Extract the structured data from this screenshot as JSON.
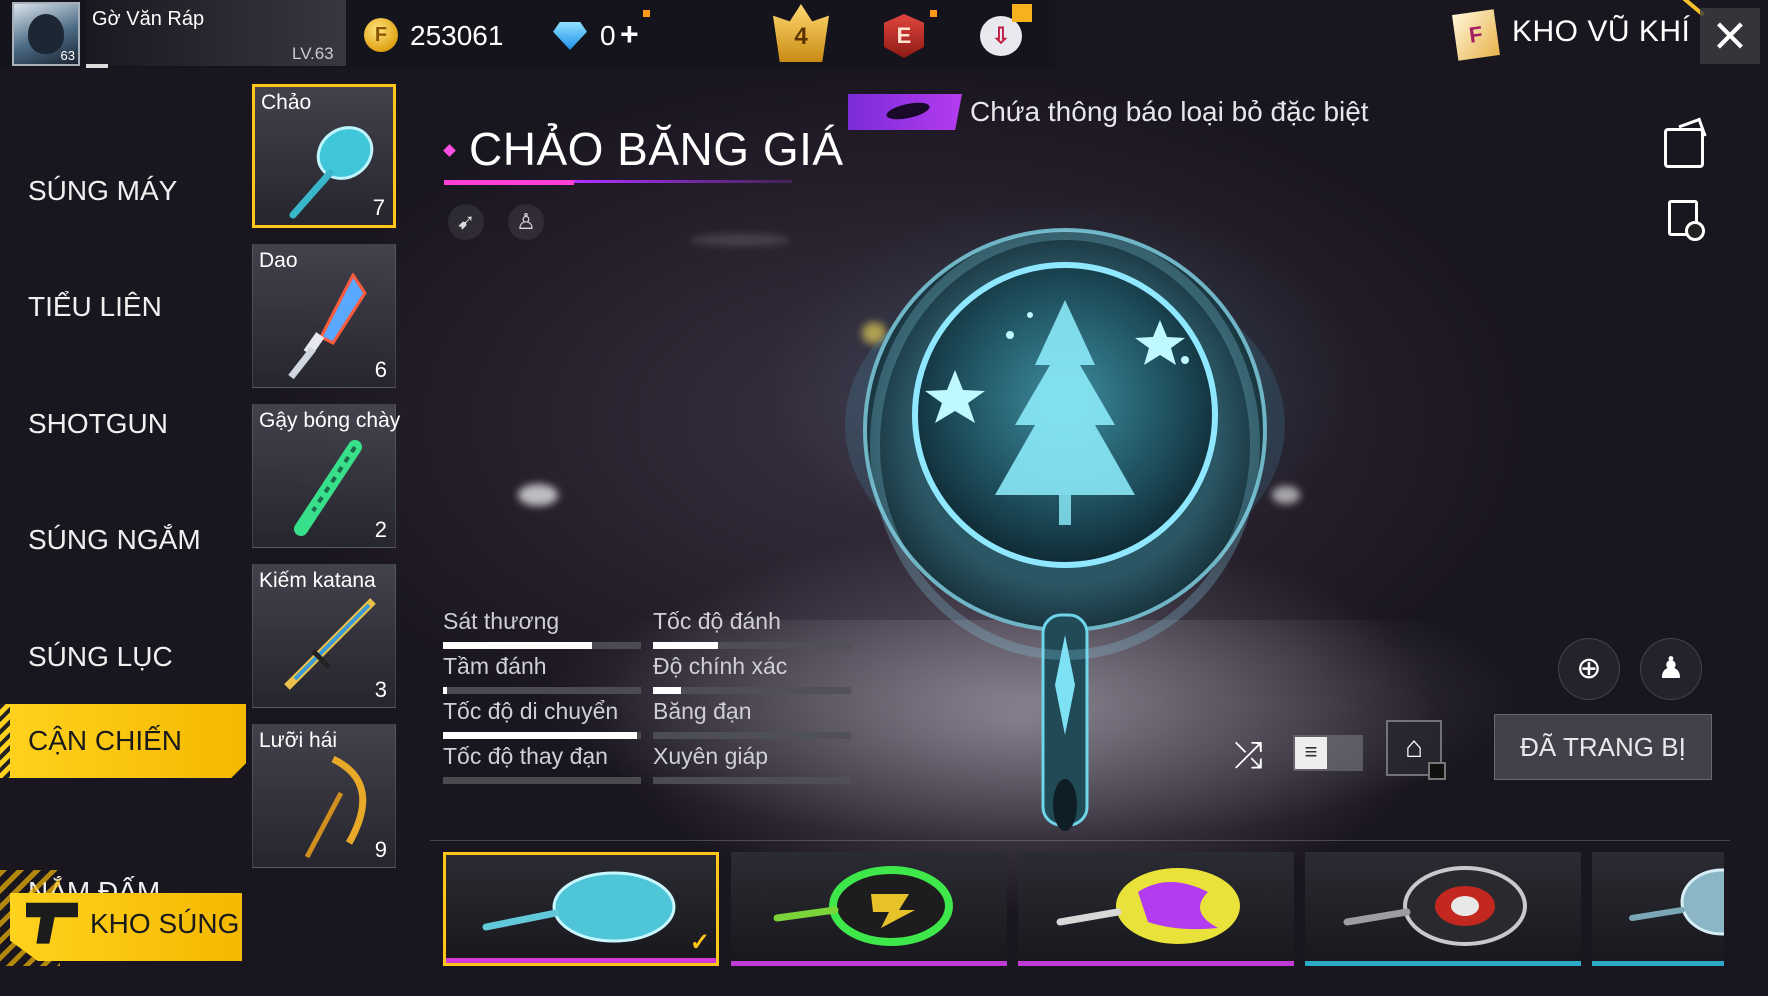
{
  "player": {
    "name": "Gờ Văn Ráp",
    "level": "LV.63",
    "avatar_level": "63"
  },
  "currency": {
    "gold": "253061",
    "diamonds": "0",
    "plus": "+"
  },
  "top_icons": {
    "rank_value": "4",
    "elite_letter": "E"
  },
  "header": {
    "title": "KHO VŨ KHÍ",
    "close": "×"
  },
  "categories": [
    {
      "label": "SÚNG MÁY",
      "active": false
    },
    {
      "label": "TIỂU LIÊN",
      "active": false
    },
    {
      "label": "SHOTGUN",
      "active": false
    },
    {
      "label": "SÚNG NGẮM",
      "active": false
    },
    {
      "label": "SÚNG LỤC",
      "active": false
    },
    {
      "label": "CẬN CHIẾN",
      "active": true
    },
    {
      "label": "NẮM ĐẤM",
      "active": false
    }
  ],
  "gun_storage": {
    "label": "KHO SÚNG"
  },
  "weapon_types": [
    {
      "name": "Chảo",
      "count": "7",
      "selected": true
    },
    {
      "name": "Dao",
      "count": "6",
      "selected": false
    },
    {
      "name": "Gậy bóng chày",
      "count": "2",
      "selected": false
    },
    {
      "name": "Kiếm katana",
      "count": "3",
      "selected": false
    },
    {
      "name": "Lưỡi hái",
      "count": "9",
      "selected": false
    }
  ],
  "weapon": {
    "title": "CHẢO BĂNG GIÁ",
    "notice": "Chứa thông báo loại bỏ đặc biệt"
  },
  "stats": [
    {
      "label": "Sát thương",
      "value": 0.75
    },
    {
      "label": "Tốc độ đánh",
      "value": 0.33
    },
    {
      "label": "Tầm đánh",
      "value": 0.02
    },
    {
      "label": "Độ chính xác",
      "value": 0.14
    },
    {
      "label": "Tốc độ di chuyển",
      "value": 0.98
    },
    {
      "label": "Băng đạn",
      "value": 0.0
    },
    {
      "label": "Tốc độ thay đạn",
      "value": 0.0
    },
    {
      "label": "Xuyên giáp",
      "value": 0.0
    }
  ],
  "actions": {
    "equipped": "ĐÃ TRANG BỊ",
    "toggle_glyph": "≡"
  },
  "skins": [
    {
      "theme": "ice",
      "selected": true,
      "bar": "#d639d8",
      "check": "✓"
    },
    {
      "theme": "green",
      "selected": false,
      "bar": "#c03ad8"
    },
    {
      "theme": "graffiti",
      "selected": false,
      "bar": "#c03ad8"
    },
    {
      "theme": "target",
      "selected": false,
      "bar": "#2aa9c9"
    },
    {
      "theme": "ice2",
      "selected": false,
      "bar": "#2aa9c9"
    }
  ],
  "colors": {
    "accent_yellow": "#ffc61a",
    "accent_magenta": "#ff3fd8",
    "notice_purple": "#9a34e8"
  }
}
